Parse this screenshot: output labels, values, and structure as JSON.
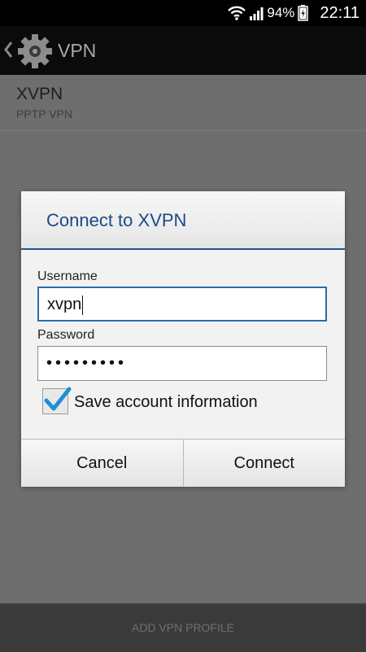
{
  "status_bar": {
    "battery": "94%",
    "time": "22:11"
  },
  "action_bar": {
    "title": "VPN"
  },
  "vpn_item": {
    "name": "XVPN",
    "type": "PPTP VPN"
  },
  "dialog": {
    "title": "Connect to XVPN",
    "username_label": "Username",
    "username_value": "xvpn",
    "password_label": "Password",
    "password_mask": "•••••••••",
    "save_label": "Save account information",
    "save_checked": true,
    "cancel_label": "Cancel",
    "connect_label": "Connect"
  },
  "bottom_bar": {
    "label": "ADD VPN PROFILE"
  },
  "colors": {
    "accent": "#1a4a86",
    "focus": "#2d6ca8",
    "check": "#1f8fd6"
  },
  "icons": [
    "wifi-icon",
    "signal-icon",
    "battery-icon",
    "back-chevron-icon",
    "gear-icon",
    "checkmark-icon"
  ]
}
